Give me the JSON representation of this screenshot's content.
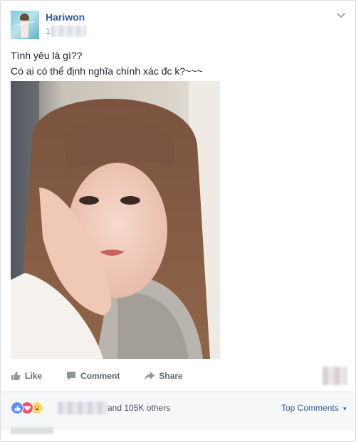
{
  "post": {
    "author": "Hariwon",
    "timestamp": "1",
    "text_line1": "Tình yêu là gì??",
    "text_line2": "Có ai có thể định nghĩa chính xác đc k?~~~",
    "menu_icon": "chevron-down-icon"
  },
  "actions": {
    "like": "Like",
    "comment": "Comment",
    "share": "Share"
  },
  "summary": {
    "reaction_icons": [
      "like-reaction-icon",
      "love-reaction-icon",
      "haha-reaction-icon"
    ],
    "others_text": "and 105K others",
    "sort_label": "Top Comments",
    "sort_caret": "▾"
  },
  "colors": {
    "link_blue": "#365899",
    "like_blue": "#5890ff",
    "love_red": "#f25268",
    "haha_yellow": "#fcd669"
  }
}
